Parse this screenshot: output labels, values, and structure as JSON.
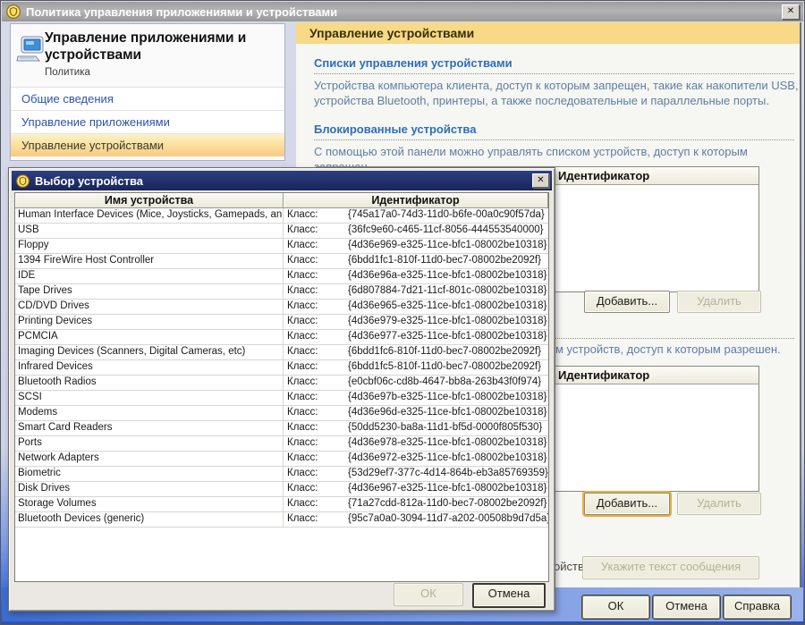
{
  "window": {
    "title": "Политика управления приложениями и устройствами"
  },
  "icons": {
    "close": "✕"
  },
  "sidebar": {
    "title": "Управление приложениями и устройствами",
    "subtitle": "Политика",
    "items": [
      {
        "label": "Общие сведения"
      },
      {
        "label": "Управление приложениями"
      },
      {
        "label": "Управление устройствами"
      }
    ]
  },
  "panel": {
    "header": "Управление устройствами",
    "sections": [
      {
        "title": "Списки управления устройствами",
        "text": "Устройства компьютера клиента, доступ к которым запрещен, такие как накопители USB, устройства Bluetooth, принтеры, а также последовательные и параллельные порты."
      },
      {
        "title": "Блокированные устройства",
        "text": "С помощью этой панели можно управлять списком устройств, доступ к которым запрещен."
      }
    ],
    "blocked_list": {
      "header": "Идентификатор",
      "add": "Добавить...",
      "remove": "Удалить"
    },
    "allowed_note_fragment": "м устройств, доступ к которым разрешен.",
    "allowed_list": {
      "header": "Идентификатор",
      "add": "Добавить...",
      "remove": "Удалить"
    },
    "message_label_fragment": "ойств",
    "message_button": "Укажите текст сообщения"
  },
  "footer": {
    "ok": "ОК",
    "cancel": "Отмена",
    "help": "Справка"
  },
  "dialog": {
    "title": "Выбор устройства",
    "columns": {
      "name": "Имя устройства",
      "id": "Идентификатор"
    },
    "class_label": "Класс:",
    "ok": "ОК",
    "cancel": "Отмена",
    "rows": [
      {
        "name": "Human Interface Devices (Mice, Joysticks, Gamepads, an...",
        "guid": "{745a17a0-74d3-11d0-b6fe-00a0c90f57da}"
      },
      {
        "name": "USB",
        "guid": "{36fc9e60-c465-11cf-8056-444553540000}"
      },
      {
        "name": "Floppy",
        "guid": "{4d36e969-e325-11ce-bfc1-08002be10318}"
      },
      {
        "name": "1394 FireWire Host Controller",
        "guid": "{6bdd1fc1-810f-11d0-bec7-08002be2092f}"
      },
      {
        "name": "IDE",
        "guid": "{4d36e96a-e325-11ce-bfc1-08002be10318}"
      },
      {
        "name": "Tape Drives",
        "guid": "{6d807884-7d21-11cf-801c-08002be10318}"
      },
      {
        "name": "CD/DVD Drives",
        "guid": "{4d36e965-e325-11ce-bfc1-08002be10318}"
      },
      {
        "name": "Printing Devices",
        "guid": "{4d36e979-e325-11ce-bfc1-08002be10318}"
      },
      {
        "name": "PCMCIA",
        "guid": "{4d36e977-e325-11ce-bfc1-08002be10318}"
      },
      {
        "name": "Imaging Devices (Scanners, Digital Cameras, etc)",
        "guid": "{6bdd1fc6-810f-11d0-bec7-08002be2092f}"
      },
      {
        "name": "Infrared Devices",
        "guid": "{6bdd1fc5-810f-11d0-bec7-08002be2092f}"
      },
      {
        "name": "Bluetooth Radios",
        "guid": "{e0cbf06c-cd8b-4647-bb8a-263b43f0f974}"
      },
      {
        "name": "SCSI",
        "guid": "{4d36e97b-e325-11ce-bfc1-08002be10318}"
      },
      {
        "name": "Modems",
        "guid": "{4d36e96d-e325-11ce-bfc1-08002be10318}"
      },
      {
        "name": "Smart Card Readers",
        "guid": "{50dd5230-ba8a-11d1-bf5d-0000f805f530}"
      },
      {
        "name": "Ports",
        "guid": "{4d36e978-e325-11ce-bfc1-08002be10318}"
      },
      {
        "name": "Network Adapters",
        "guid": "{4d36e972-e325-11ce-bfc1-08002be10318}"
      },
      {
        "name": "Biometric",
        "guid": "{53d29ef7-377c-4d14-864b-eb3a85769359}"
      },
      {
        "name": "Disk Drives",
        "guid": "{4d36e967-e325-11ce-bfc1-08002be10318}"
      },
      {
        "name": "Storage Volumes",
        "guid": "{71a27cdd-812a-11d0-bec7-08002be2092f}"
      },
      {
        "name": "Bluetooth Devices (generic)",
        "guid": "{95c7a0a0-3094-11d7-a202-00508b9d7d5a}"
      }
    ]
  },
  "colors": {
    "header_yellow": "#f7d988",
    "selected_item_orange": "#f7c983",
    "dialog_titlebar_navy": "#1e2e66",
    "link_blue": "#2d52ab",
    "heading_blue": "#2e6fba",
    "body_text_blue": "#5f7ea6",
    "footer_blue": "#3c6cd2"
  }
}
